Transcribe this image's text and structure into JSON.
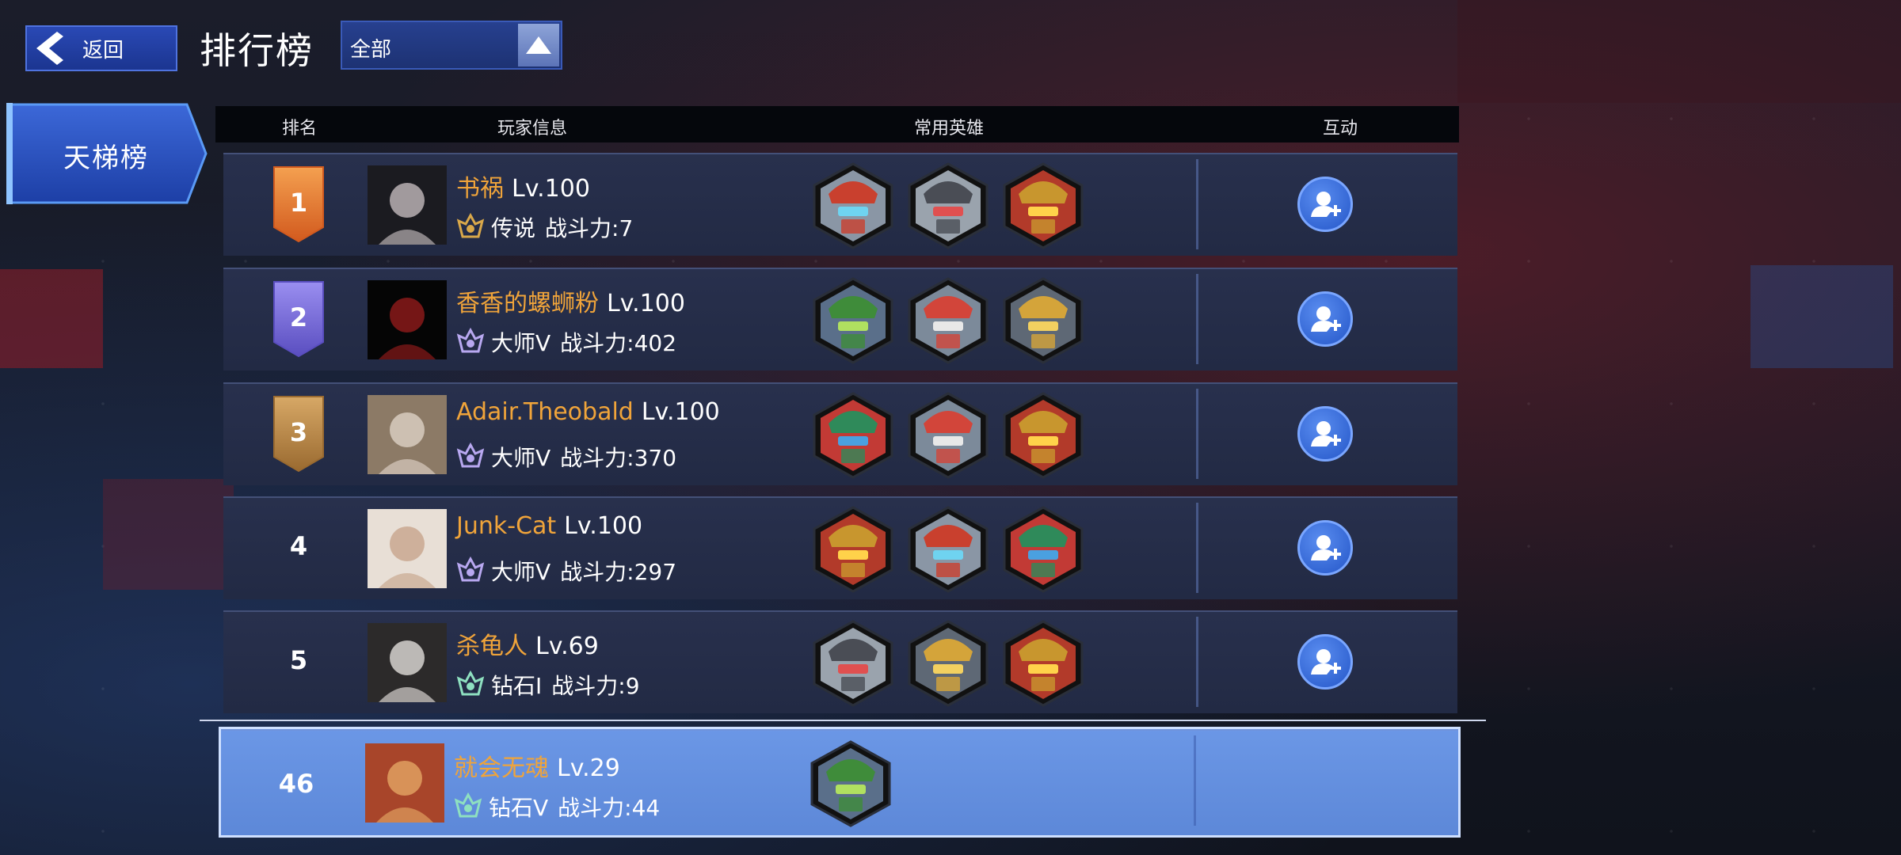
{
  "header": {
    "back_label": "返回",
    "title": "排行榜",
    "filter_value": "全部"
  },
  "sidebar": {
    "tabs": [
      {
        "label": "天梯榜",
        "active": true
      }
    ]
  },
  "table": {
    "columns": [
      "排名",
      "玩家信息",
      "常用英雄",
      "互动"
    ],
    "rows": [
      {
        "rank": "1",
        "badge": "orange",
        "name": "书祸",
        "level": "Lv.100",
        "tier": "传说",
        "power": "战斗力:7",
        "heroes": [
          "red-hat-robot-hero",
          "gray-hat-robot-hero",
          "gold-crown-robot-hero"
        ],
        "add_friend": true
      },
      {
        "rank": "2",
        "badge": "purple",
        "name": "香香的螺蛳粉",
        "level": "Lv.100",
        "tier": "大师V",
        "power": "战斗力:402",
        "heroes": [
          "green-mech-hero",
          "red-helmet-robot-hero",
          "gold-yellow-robot-hero"
        ],
        "add_friend": true
      },
      {
        "rank": "3",
        "badge": "bronze",
        "name": "Adair.Theobald",
        "level": "Lv.100",
        "tier": "大师V",
        "power": "战斗力:370",
        "heroes": [
          "green-red-mech-hero",
          "red-helmet-robot-hero",
          "gold-crown-robot-hero"
        ],
        "add_friend": true
      },
      {
        "rank": "4",
        "badge": "none",
        "name": "Junk-Cat",
        "level": "Lv.100",
        "tier": "大师V",
        "power": "战斗力:297",
        "heroes": [
          "gold-crown-robot-hero",
          "red-hat-robot-hero",
          "green-red-mech-hero"
        ],
        "add_friend": true
      },
      {
        "rank": "5",
        "badge": "none",
        "name": "杀龟人",
        "level": "Lv.69",
        "tier": "钻石I",
        "power": "战斗力:9",
        "heroes": [
          "gray-hat-robot-hero",
          "gold-yellow-robot-hero",
          "gold-crown-robot-hero"
        ],
        "add_friend": true
      }
    ],
    "self_row": {
      "rank": "46",
      "name": "就会无魂",
      "level": "Lv.29",
      "tier": "钻石V",
      "power": "战斗力:44",
      "heroes": [
        "green-mech-hero"
      ]
    }
  },
  "colors": {
    "accent": "#2a49b5",
    "name_orange": "#f0a43a",
    "self_row_bg": "#6b97e6",
    "row_bg": "#252d48"
  }
}
